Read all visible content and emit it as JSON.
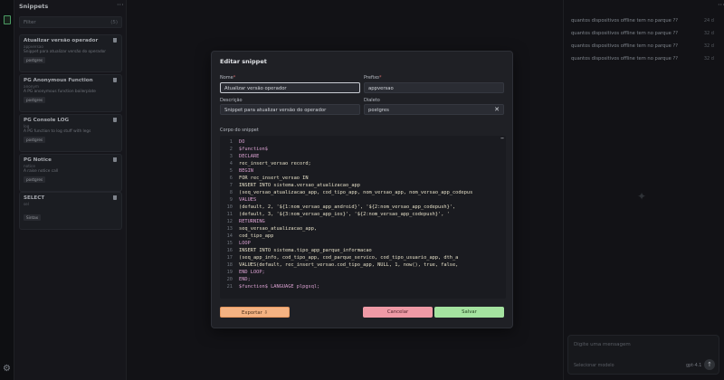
{
  "sidebar": {
    "title": "Snippets",
    "filter_placeholder": "Filter",
    "filter_count": "(5)",
    "cards": [
      {
        "title": "Atualizar versão operador",
        "prefix": "appversao",
        "desc": "Snippet para atualizar versão do operador",
        "tag": "postgres"
      },
      {
        "title": "PG Anonymous Function",
        "prefix": "anonym",
        "desc": "A PG anonymous function boilerplate",
        "tag": "postgres"
      },
      {
        "title": "PG Console LOG",
        "prefix": "log",
        "desc": "A PG function to log stuff with legs",
        "tag": "postgres"
      },
      {
        "title": "PG Notice",
        "prefix": "notice",
        "desc": "A raise notice call",
        "tag": "postgres"
      },
      {
        "title": "SELECT",
        "prefix": "sel",
        "desc": "",
        "tag": "Sintax"
      }
    ]
  },
  "chat": {
    "messages": [
      {
        "text": "quantos dispositivos offline tem no parque ??",
        "time": "24 d"
      },
      {
        "text": "quantos dispositivos offline tem no parque ??",
        "time": "32 d"
      },
      {
        "text": "quantos dispositivos offline tem no parque ??",
        "time": "32 d"
      },
      {
        "text": "quantos dispositivos offline tem no parque ??",
        "time": "32 d"
      }
    ],
    "input_placeholder": "Digite uma mensagem",
    "model_label": "Selecionar modelo",
    "model_name": "gpt-4.1"
  },
  "modal": {
    "title": "Editar snippet",
    "name_label": "Nome",
    "name_value": "Atualizar versão operador",
    "prefix_label": "Prefixo",
    "prefix_value": "appversao",
    "desc_label": "Descrição",
    "desc_value": "Snippet para atualizar versão do operador",
    "dialect_label": "Dialeto",
    "dialect_value": "postgres",
    "body_label": "Corpo do snippet",
    "code": [
      "DO",
      "$function$",
      "DECLARE",
      "    rec_insert_versao record;",
      "BEGIN",
      "    FOR rec_insert_versao IN",
      "    INSERT INTO sistema.versao_atualizacao_app",
      "    (seq_versao_atualizacao_app, cod_tipo_app, nom_versao_app, nom_versao_app_codepus",
      "    VALUES",
      "        (default, 2, '${1:nom_versao_app_android}', '${2:nom_versao_app_codepush}',",
      "        (default, 3, '${3:nom_versao_app_ios}', '${2:nom_versao_app_codepush}', '",
      "    RETURNING",
      "        seq_versao_atualizacao_app,",
      "        cod_tipo_app",
      "    LOOP",
      "        INSERT INTO sistema.tipo_app_parque_informacao",
      "        (seq_app_info, cod_tipo_app, cod_parque_servico, cod_tipo_usuario_app, dth_a",
      "        VALUES(default, rec_insert_versao.cod_tipo_app, NULL, 1, now(), true, false,",
      "    END LOOP;",
      "END;",
      "$function$ LANGUAGE plpgsql;"
    ],
    "export_label": "Exportar",
    "cancel_label": "Cancelar",
    "save_label": "Salvar"
  }
}
